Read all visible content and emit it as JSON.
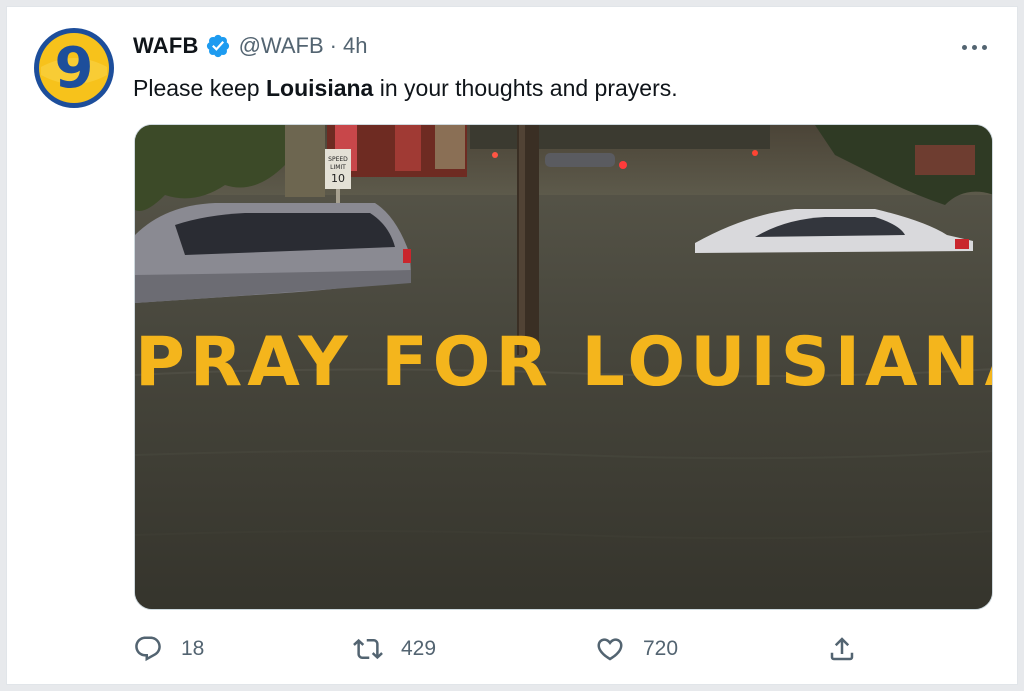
{
  "tweet": {
    "author": {
      "name": "WAFB",
      "handle": "@WAFB",
      "dot": "·",
      "time": "4h",
      "avatar_glyph": "9"
    },
    "text": {
      "before": "Please keep ",
      "bold": "Louisiana",
      "after": " in your thoughts and prayers."
    },
    "media": {
      "overlay_text": "PRAY FOR LOUISIANA",
      "sign_speed": "SPEED",
      "sign_limit": "LIMIT",
      "sign_value": "10"
    },
    "actions": {
      "reply": {
        "icon": "reply-icon",
        "count": "18"
      },
      "retweet": {
        "icon": "retweet-icon",
        "count": "429"
      },
      "like": {
        "icon": "heart-icon",
        "count": "720"
      },
      "share": {
        "icon": "share-icon"
      }
    }
  },
  "colors": {
    "verified": "#1d9bf0",
    "overlay": "#f4b51c",
    "avatar_ring": "#1d4e9b",
    "avatar_fill": "#f7c21b"
  }
}
